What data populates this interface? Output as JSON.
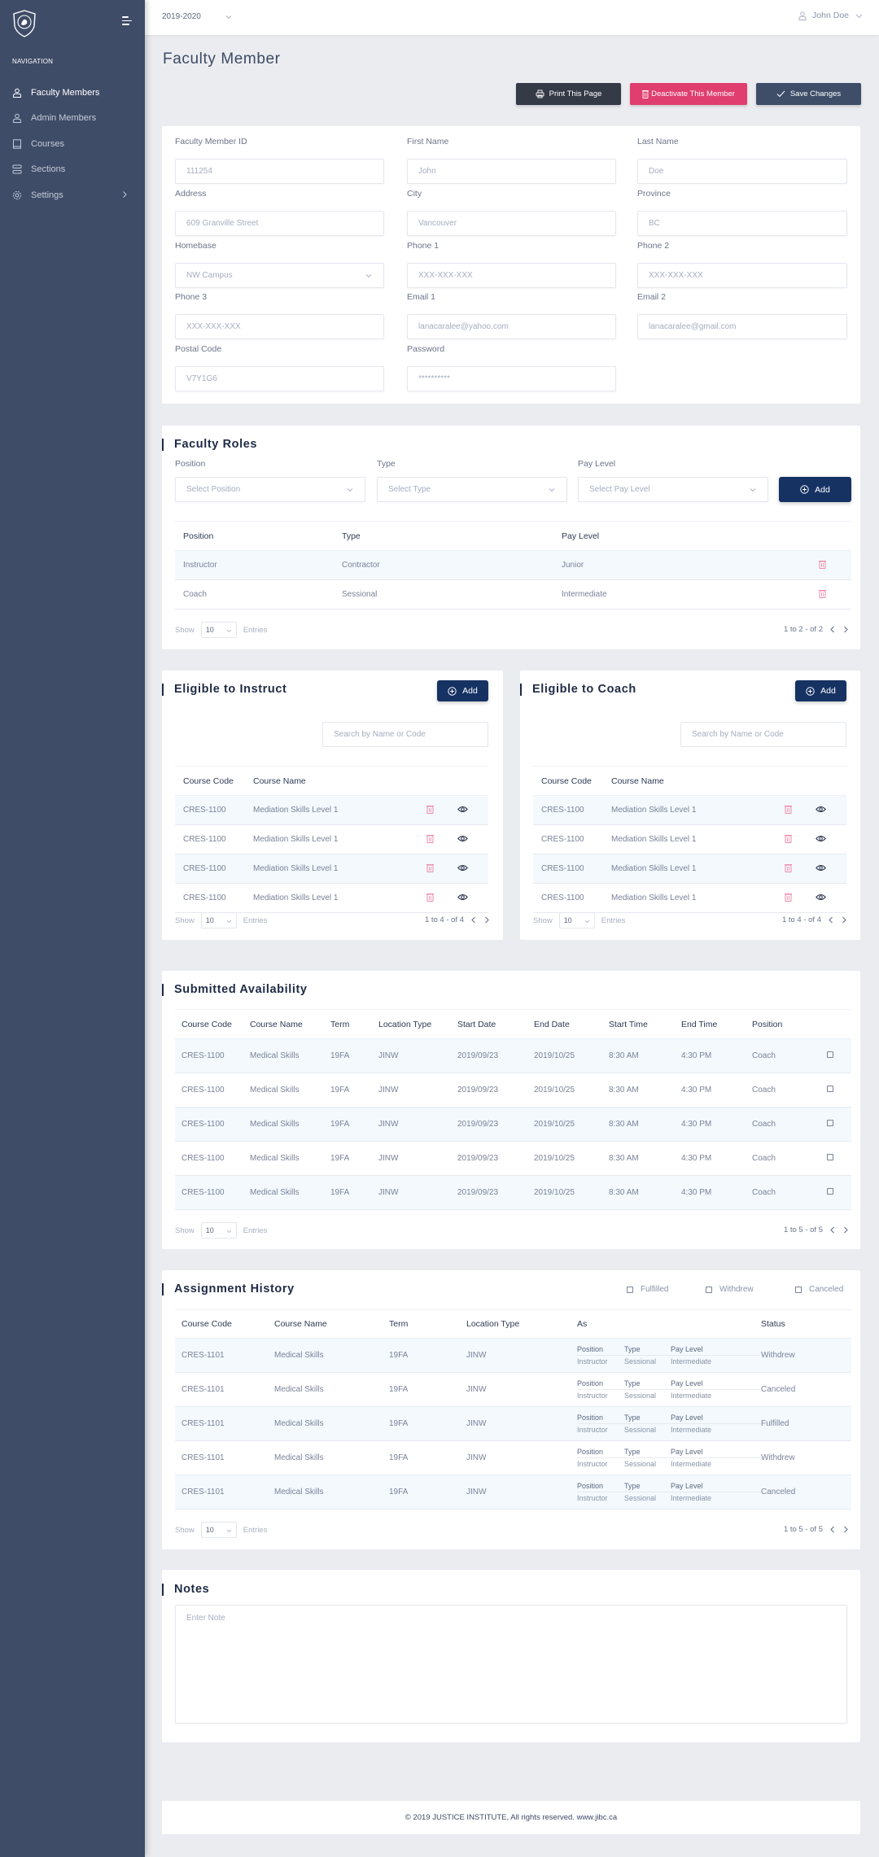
{
  "topbar": {
    "year": "2019-2020",
    "user": "John Doe"
  },
  "sidebar": {
    "heading": "NAVIGATION",
    "items": [
      {
        "label": "Faculty Members",
        "icon": "user-icon",
        "active": true
      },
      {
        "label": "Admin Members",
        "icon": "user-icon",
        "active": false
      },
      {
        "label": "Courses",
        "icon": "book-icon",
        "active": false
      },
      {
        "label": "Sections",
        "icon": "sections-icon",
        "active": false
      },
      {
        "label": "Settings",
        "icon": "gear-icon",
        "active": false,
        "has_submenu": true
      }
    ]
  },
  "page": {
    "title": "Faculty Member",
    "actions": {
      "print": "Print This Page",
      "deactivate": "Deactivate This Member",
      "save": "Save Changes"
    }
  },
  "profile": {
    "faculty_id": {
      "label": "Faculty Member ID",
      "value": "111254"
    },
    "first_name": {
      "label": "First Name",
      "value": "John"
    },
    "last_name": {
      "label": "Last Name",
      "value": "Doe"
    },
    "address": {
      "label": "Address",
      "value": "609 Granville Street"
    },
    "city": {
      "label": "City",
      "value": "Vancouver"
    },
    "province": {
      "label": "Province",
      "value": "BC"
    },
    "homebase": {
      "label": "Homebase",
      "value": "NW Campus"
    },
    "phone1": {
      "label": "Phone 1",
      "placeholder": "XXX-XXX-XXX"
    },
    "phone2": {
      "label": "Phone 2",
      "placeholder": "XXX-XXX-XXX"
    },
    "phone3": {
      "label": "Phone 3",
      "placeholder": "XXX-XXX-XXX"
    },
    "email1": {
      "label": "Email 1",
      "value": "lanacaralee@yahoo.com"
    },
    "email2": {
      "label": "Email 2",
      "value": "lanacaralee@gmail.com"
    },
    "postal_code": {
      "label": "Postal Code",
      "value": "V7Y1G6"
    },
    "password": {
      "label": "Password",
      "value": "**********"
    }
  },
  "faculty_roles": {
    "title": "Faculty Roles",
    "position": {
      "label": "Position",
      "placeholder": "Select Position"
    },
    "type": {
      "label": "Type",
      "placeholder": "Select Type"
    },
    "pay_level": {
      "label": "Pay Level",
      "placeholder": "Select Pay Level"
    },
    "add_label": "Add",
    "columns": [
      "Position",
      "Type",
      "Pay Level"
    ],
    "rows": [
      [
        "Instructor",
        "Contractor",
        "Junior"
      ],
      [
        "Coach",
        "Sessional",
        "Intermediate"
      ]
    ],
    "show_label": "Show",
    "entries_value": "10",
    "entries_label": "Entries",
    "pagination": "1 to 2 - of  2"
  },
  "eligible_instruct": {
    "title": "Eligible to Instruct",
    "add_label": "Add",
    "search_placeholder": "Search by Name or Code",
    "columns": [
      "Course Code",
      "Course  Name"
    ],
    "rows": [
      [
        "CRES-1100",
        "Mediation Skills Level 1"
      ],
      [
        "CRES-1100",
        "Mediation Skills Level 1"
      ],
      [
        "CRES-1100",
        "Mediation Skills Level 1"
      ],
      [
        "CRES-1100",
        "Mediation Skills Level 1"
      ]
    ],
    "show_label": "Show",
    "entries_value": "10",
    "entries_label": "Entries",
    "pagination": "1 to 4 - of  4"
  },
  "eligible_coach": {
    "title": "Eligible to Coach",
    "add_label": "Add",
    "search_placeholder": "Search by Name or Code",
    "columns": [
      "Course Code",
      "Course  Name"
    ],
    "rows": [
      [
        "CRES-1100",
        "Mediation Skills Level 1"
      ],
      [
        "CRES-1100",
        "Mediation Skills Level 1"
      ],
      [
        "CRES-1100",
        "Mediation Skills Level 1"
      ],
      [
        "CRES-1100",
        "Mediation Skills Level 1"
      ]
    ],
    "show_label": "Show",
    "entries_value": "10",
    "entries_label": "Entries",
    "pagination": "1 to 4 - of  4"
  },
  "availability": {
    "title": "Submitted Availability",
    "columns": [
      "Course Code",
      "Course Name",
      "Term",
      "Location Type",
      "Start Date",
      "End Date",
      "Start Time",
      "End Time",
      "Position"
    ],
    "rows": [
      [
        "CRES-1100",
        "Medical Skills",
        "19FA",
        "JINW",
        "2019/09/23",
        "2019/10/25",
        "8:30 AM",
        "4:30 PM",
        "Coach"
      ],
      [
        "CRES-1100",
        "Medical Skills",
        "19FA",
        "JINW",
        "2019/09/23",
        "2019/10/25",
        "8:30 AM",
        "4:30 PM",
        "Coach"
      ],
      [
        "CRES-1100",
        "Medical Skills",
        "19FA",
        "JINW",
        "2019/09/23",
        "2019/10/25",
        "8:30 AM",
        "4:30 PM",
        "Coach"
      ],
      [
        "CRES-1100",
        "Medical Skills",
        "19FA",
        "JINW",
        "2019/09/23",
        "2019/10/25",
        "8:30 AM",
        "4:30 PM",
        "Coach"
      ],
      [
        "CRES-1100",
        "Medical Skills",
        "19FA",
        "JINW",
        "2019/09/23",
        "2019/10/25",
        "8:30 AM",
        "4:30 PM",
        "Coach"
      ]
    ],
    "show_label": "Show",
    "entries_value": "10",
    "entries_label": "Entries",
    "pagination": "1 to 5 - of  5"
  },
  "assignment_history": {
    "title": "Assignment History",
    "filters": [
      "Fulfilled",
      "Withdrew",
      "Canceled"
    ],
    "columns": [
      "Course Code",
      "Course Name",
      "Term",
      "Location Type",
      "As",
      "Status"
    ],
    "as_headers": [
      "Position",
      "Type",
      "Pay Level"
    ],
    "rows": [
      {
        "code": "CRES-1101",
        "name": "Medical Skills",
        "term": "19FA",
        "location": "JINW",
        "as": [
          "Instructor",
          "Sessional",
          "Intermediate"
        ],
        "status": "Withdrew"
      },
      {
        "code": "CRES-1101",
        "name": "Medical Skills",
        "term": "19FA",
        "location": "JINW",
        "as": [
          "Instructor",
          "Sessional",
          "Intermediate"
        ],
        "status": "Canceled"
      },
      {
        "code": "CRES-1101",
        "name": "Medical Skills",
        "term": "19FA",
        "location": "JINW",
        "as": [
          "Instructor",
          "Sessional",
          "Intermediate"
        ],
        "status": "Fulfilled"
      },
      {
        "code": "CRES-1101",
        "name": "Medical Skills",
        "term": "19FA",
        "location": "JINW",
        "as": [
          "Instructor",
          "Sessional",
          "Intermediate"
        ],
        "status": "Withdrew"
      },
      {
        "code": "CRES-1101",
        "name": "Medical Skills",
        "term": "19FA",
        "location": "JINW",
        "as": [
          "Instructor",
          "Sessional",
          "Intermediate"
        ],
        "status": "Canceled"
      }
    ],
    "show_label": "Show",
    "entries_value": "10",
    "entries_label": "Entries",
    "pagination": "1 to 5 - of  5"
  },
  "notes": {
    "title": "Notes",
    "placeholder": "Enter Note"
  },
  "footer": {
    "text": "© 2019 JUSTICE INSTITUTE,  All rights reserved. www.jibc.ca"
  },
  "colors": {
    "sidebar": "#3f4c67",
    "primary": "#163263",
    "danger": "#e03e6f",
    "dark": "#343a46"
  }
}
